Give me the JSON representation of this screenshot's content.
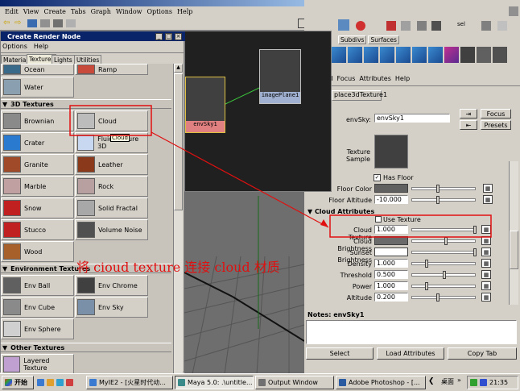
{
  "maya": {
    "title": "",
    "menu": [
      "Edit",
      "View",
      "Create",
      "Tabs",
      "Graph",
      "Window",
      "Options",
      "Help"
    ]
  },
  "hypershade": {
    "title": "Create Render Node",
    "menu": [
      "Options",
      "Help"
    ],
    "tabs": [
      "Materials",
      "Textures",
      "Lights",
      "Utilities"
    ],
    "active_tab": "Textures",
    "top_items": [
      {
        "label": "Ocean",
        "swatch": "#3a6a8a"
      },
      {
        "label": "Ramp",
        "swatch": "#c84a3a"
      },
      {
        "label": "Water",
        "swatch": "#8aa0b0"
      }
    ],
    "sections": {
      "textures_3d": "3D Textures",
      "env_textures": "Environment Textures",
      "other_textures": "Other Textures"
    },
    "textures_3d": [
      {
        "label": "Brownian",
        "swatch": "#8a8a8a"
      },
      {
        "label": "Cloud",
        "swatch": "#bcbcbc"
      },
      {
        "label": "Crater",
        "swatch": "#2a7ad0"
      },
      {
        "label": "Fluid Texture 3D",
        "swatch": "#c8d8f0"
      },
      {
        "label": "Granite",
        "swatch": "#a04a2a"
      },
      {
        "label": "Leather",
        "swatch": "#8a3a1a"
      },
      {
        "label": "Marble",
        "swatch": "#c0a0a0"
      },
      {
        "label": "Rock",
        "swatch": "#b8a0a0"
      },
      {
        "label": "Snow",
        "swatch": "#c02020"
      },
      {
        "label": "Solid Fractal",
        "swatch": "#a8a8a8"
      },
      {
        "label": "Stucco",
        "swatch": "#c02020"
      },
      {
        "label": "Volume Noise",
        "swatch": "#505050"
      },
      {
        "label": "Wood",
        "swatch": "#a8602a"
      }
    ],
    "env_textures": [
      {
        "label": "Env Ball",
        "swatch": "#606060"
      },
      {
        "label": "Env Chrome",
        "swatch": "#404040"
      },
      {
        "label": "Env Cube",
        "swatch": "#8a8a8a"
      },
      {
        "label": "Env Sky",
        "swatch": "#7a90a8"
      },
      {
        "label": "Env Sphere",
        "swatch": "#d0d0d0"
      }
    ],
    "other_textures": [
      {
        "label": "Layered Texture",
        "swatch": "#c0a0d0"
      }
    ],
    "tooltip": "Cloud"
  },
  "graph": {
    "node_a": "envSky1",
    "node_b": "imagePlane1"
  },
  "right": {
    "tabs": [
      "Subdivs",
      "Surfaces"
    ],
    "menu": [
      "cted",
      "Focus",
      "Attributes",
      "Help"
    ],
    "tab_node": "place3dTexture1",
    "envsky_label": "envSky:",
    "envsky_value": "envSky1",
    "focus": "Focus",
    "presets": "Presets",
    "sample_label": "Texture Sample",
    "has_floor": "Has Floor",
    "floor_color": "Floor Color",
    "floor_altitude": "Floor Altitude",
    "floor_altitude_value": "-10.000",
    "cloud_section": "Cloud Attributes",
    "use_texture": "Use Texture",
    "cloud_texture": "Cloud Texture",
    "cloud_texture_value": "1.000",
    "cloud_brightness": "Cloud Brightness",
    "sunset_brightness": "Sunset Brightness",
    "density": "Density",
    "density_value": "1.000",
    "threshold": "Threshold",
    "threshold_value": "0.500",
    "power": "Power",
    "power_value": "1.000",
    "altitude": "Altitude",
    "altitude_value": "0.200",
    "notes": "Notes: envSky1",
    "select": "Select",
    "load_attrs": "Load Attributes",
    "copy_tab": "Copy Tab"
  },
  "annotation": "将 cioud texture 连接 cloud 材质",
  "taskbar": {
    "start": "开始",
    "tasks": [
      "MyIE2 - [火星时代动...",
      "Maya 5.0: .\\untitle...",
      "Output Window",
      "Adobe Photoshop - [..."
    ],
    "tray_label": "桌面",
    "clock": "21:35"
  }
}
